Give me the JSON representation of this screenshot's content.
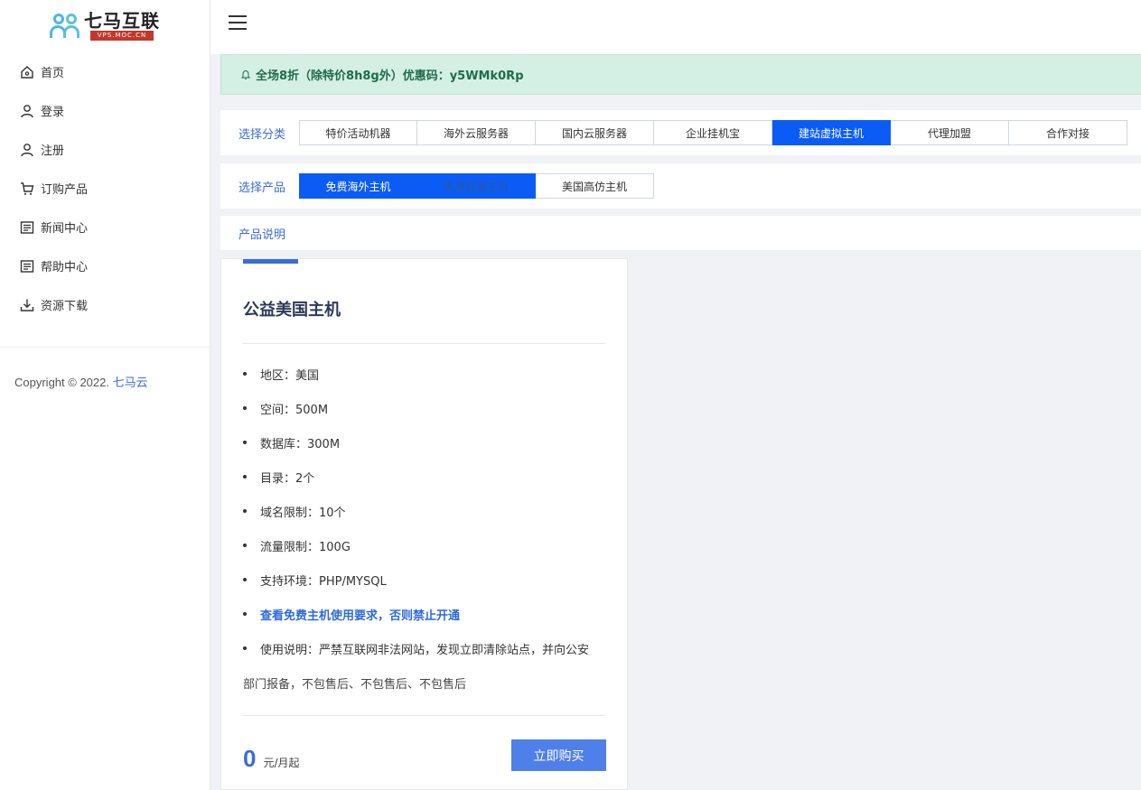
{
  "brand": {
    "name": "七马互联",
    "sub": "VPS.MOC.CN"
  },
  "sidebar": {
    "items": [
      {
        "label": "首页",
        "icon": "home-icon"
      },
      {
        "label": "登录",
        "icon": "user-icon"
      },
      {
        "label": "注册",
        "icon": "user-icon"
      },
      {
        "label": "订购产品",
        "icon": "cart-icon"
      },
      {
        "label": "新闻中心",
        "icon": "document-icon"
      },
      {
        "label": "帮助中心",
        "icon": "document-icon"
      },
      {
        "label": "资源下载",
        "icon": "download-icon"
      }
    ],
    "copyright_prefix": "Copyright © 2022.",
    "copyright_link": "七马云"
  },
  "notice": {
    "text": "全场8折（除特价8h8g外）优惠码：y5WMk0Rp"
  },
  "category": {
    "label": "选择分类",
    "tabs": [
      "特价活动机器",
      "海外云服务器",
      "国内云服务器",
      "企业挂机宝",
      "建站虚拟主机",
      "代理加盟",
      "合作对接"
    ],
    "active_index": 4
  },
  "product": {
    "label": "选择产品",
    "tabs": [
      "免费海外主机",
      "香港高速主机",
      "美国高仿主机"
    ],
    "active_index": 0
  },
  "description": {
    "label": "产品说明"
  },
  "card": {
    "title": "公益美国主机",
    "features": [
      "地区：美国",
      "空间：500M",
      "数据库：300M",
      "目录：2个",
      "域名限制：10个",
      "流量限制：100G",
      "支持环境：PHP/MYSQL"
    ],
    "link": "查看免费主机使用要求，否则禁止开通",
    "usage": "使用说明：严禁互联网非法网站，发现立即清除站点，并向公安",
    "extra": "部门报备，不包售后、不包售后、不包售后",
    "price": "0",
    "price_unit": "元/月起",
    "buy_label": "立即购买"
  },
  "colors": {
    "accent": "#3c6dd6",
    "active_tab": "#0b5cf5",
    "notice_bg": "#d4f0e5"
  }
}
